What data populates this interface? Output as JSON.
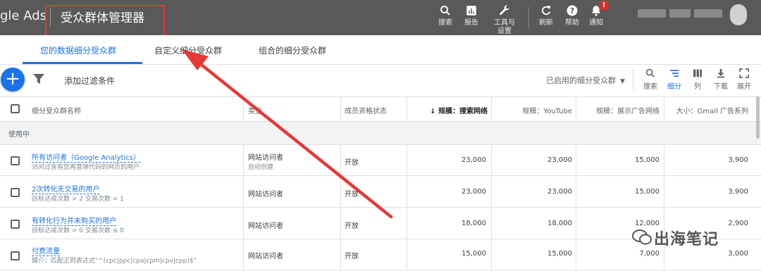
{
  "topbar": {
    "brand": "gle Ads",
    "page_title": "受众群体管理器",
    "tools": [
      {
        "icon": "search-icon",
        "label": "搜索"
      },
      {
        "icon": "report-icon",
        "label": "报告"
      },
      {
        "icon": "wrench-icon",
        "label": "工具与\n设置"
      },
      {
        "icon": "refresh-icon",
        "label": "刷新"
      },
      {
        "icon": "help-icon",
        "label": "帮助"
      },
      {
        "icon": "bell-icon",
        "label": "通知"
      }
    ],
    "notification_badge": "!"
  },
  "tabs": [
    {
      "label": "您的数据细分受众群",
      "active": true
    },
    {
      "label": "自定义细分受众群",
      "active": false
    },
    {
      "label": "组合的细分受众群",
      "active": false
    }
  ],
  "toolbar": {
    "add_button": "+",
    "add_filter": "添加过滤条件",
    "dropdown_label": "已启用的细分受众群",
    "view_tools": [
      {
        "icon": "search-icon",
        "label": "搜索"
      },
      {
        "icon": "segment-icon",
        "label": "细分"
      },
      {
        "icon": "columns-icon",
        "label": "列"
      },
      {
        "icon": "download-icon",
        "label": "下载"
      },
      {
        "icon": "expand-icon",
        "label": "展开"
      }
    ]
  },
  "table": {
    "headers": {
      "name": "细分受众群名称",
      "type": "类型",
      "status": "成员资格状态",
      "search": "↓ 规模：搜索网络",
      "youtube": "规模：YouTube",
      "display": "规模：展示广告网络",
      "gmail": "大小：Gmail 广告系列"
    },
    "group_label": "使用中",
    "rows": [
      {
        "name": "所有访问者（Google Analytics）",
        "desc": "访问过含有您再营销代码的网页的用户",
        "type": "网站访问者",
        "type_sub": "自动创建",
        "status": "开放",
        "search": "23,000",
        "youtube": "23,000",
        "display": "15,000",
        "gmail": "3,900"
      },
      {
        "name": "2次转化无交易的用户",
        "desc": "目标达成次数 > 2 交易次数 < 1",
        "type": "网站访问者",
        "type_sub": "",
        "status": "开放",
        "search": "23,000",
        "youtube": "23,000",
        "display": "15,000",
        "gmail": "3,900"
      },
      {
        "name": "有转化行为并未购买的用户",
        "desc": "目标达成次数 > 0 交易次数 ≤ 0",
        "type": "网站访问者",
        "type_sub": "",
        "status": "开放",
        "search": "18,000",
        "youtube": "18,000",
        "display": "12,000",
        "gmail": "2,900"
      },
      {
        "name": "付费流量",
        "desc": "媒介：匹配正则表达式\"^(cpc|ppc|cpa|cpm|cpv|cpp)$\"",
        "type": "网站访问者",
        "type_sub": "",
        "status": "开放",
        "search": "15,000",
        "youtube": "15,000",
        "display": "7,000",
        "gmail": "3,000"
      }
    ]
  },
  "watermark": "出海笔记",
  "colors": {
    "accent": "#1a73e8",
    "topbar": "#595959",
    "annotation": "#e53935"
  }
}
